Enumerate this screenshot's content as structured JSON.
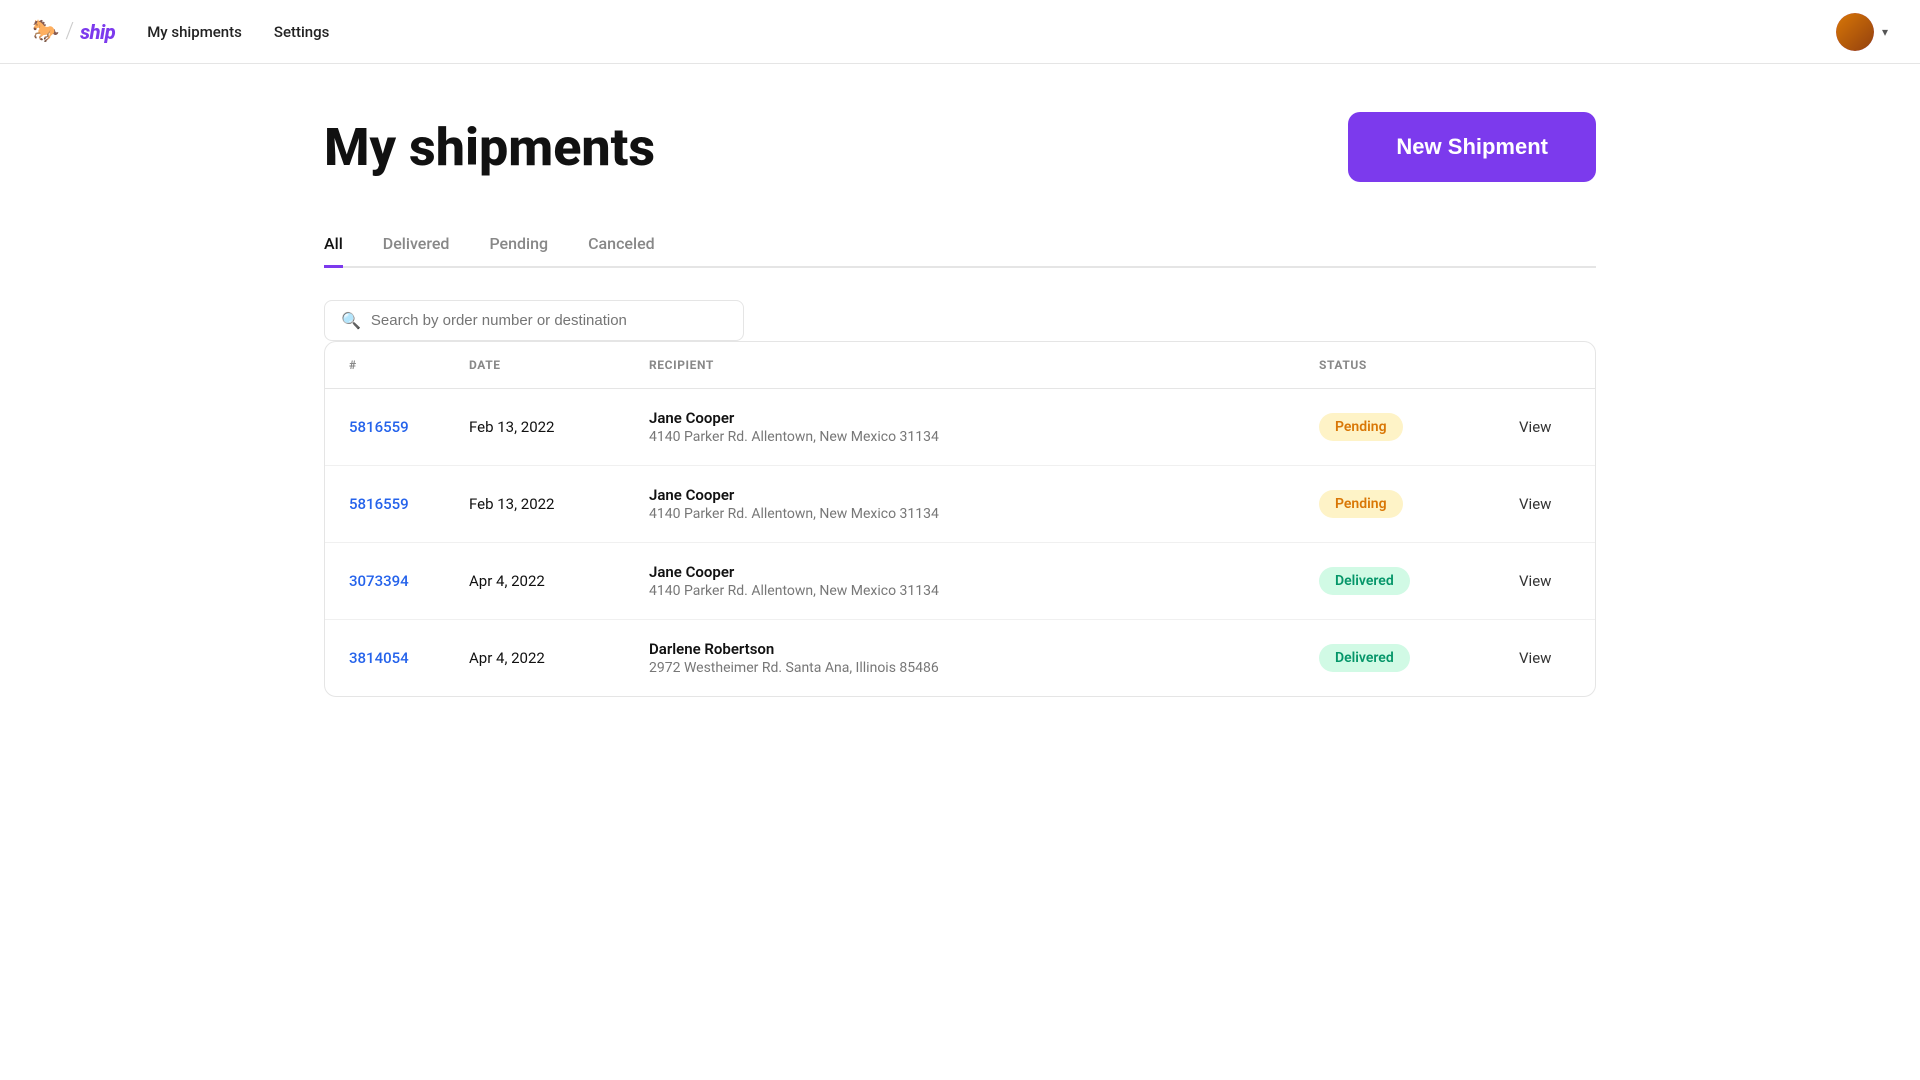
{
  "nav": {
    "logo_icon": "🐎",
    "logo_slash": "/",
    "logo_text": "ship",
    "links": [
      {
        "label": "My shipments",
        "href": "#",
        "active": true
      },
      {
        "label": "Settings",
        "href": "#",
        "active": false
      }
    ]
  },
  "page": {
    "title": "My shipments",
    "new_shipment_label": "New Shipment"
  },
  "tabs": [
    {
      "label": "All",
      "active": true
    },
    {
      "label": "Delivered",
      "active": false
    },
    {
      "label": "Pending",
      "active": false
    },
    {
      "label": "Canceled",
      "active": false
    }
  ],
  "search": {
    "placeholder": "Search by order number or destination"
  },
  "table": {
    "columns": [
      "#",
      "DATE",
      "RECIPIENT",
      "STATUS",
      ""
    ],
    "rows": [
      {
        "order": "5816559",
        "date": "Feb 13, 2022",
        "recipient_name": "Jane Cooper",
        "recipient_address": "4140 Parker Rd. Allentown, New Mexico 31134",
        "status": "Pending",
        "status_class": "status-pending",
        "action": "View"
      },
      {
        "order": "5816559",
        "date": "Feb 13, 2022",
        "recipient_name": "Jane Cooper",
        "recipient_address": "4140 Parker Rd. Allentown, New Mexico 31134",
        "status": "Pending",
        "status_class": "status-pending",
        "action": "View"
      },
      {
        "order": "3073394",
        "date": "Apr 4, 2022",
        "recipient_name": "Jane Cooper",
        "recipient_address": "4140 Parker Rd. Allentown, New Mexico 31134",
        "status": "Delivered",
        "status_class": "status-delivered",
        "action": "View"
      },
      {
        "order": "3814054",
        "date": "Apr 4, 2022",
        "recipient_name": "Darlene Robertson",
        "recipient_address": "2972 Westheimer Rd. Santa Ana, Illinois 85486",
        "status": "Delivered",
        "status_class": "status-delivered",
        "action": "View"
      }
    ]
  }
}
